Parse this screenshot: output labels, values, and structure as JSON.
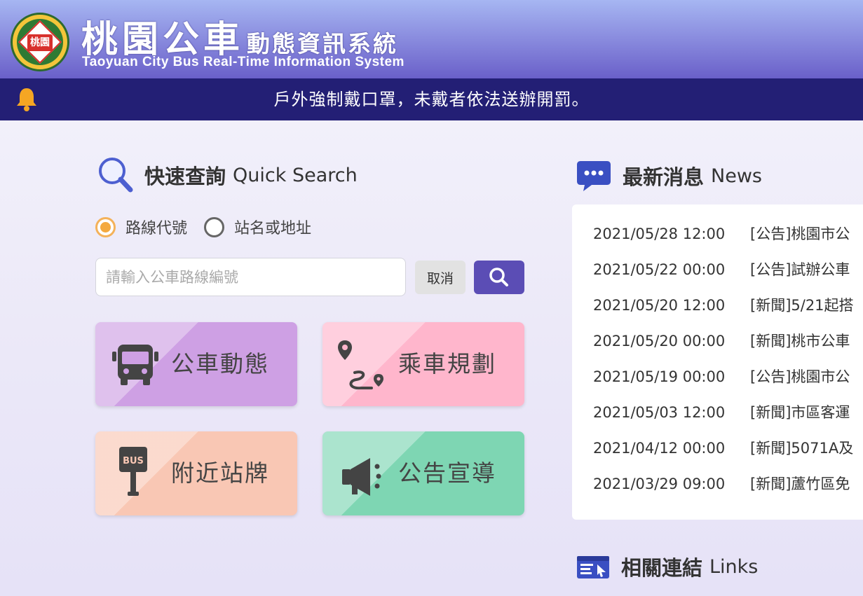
{
  "header": {
    "logo_text": "桃園",
    "title_main": "桃園公車",
    "title_sub": "動態資訊系統",
    "title_en": "Taoyuan City Bus Real-Time Information System"
  },
  "announcement": {
    "text": "戶外強制戴口罩，未戴者依法送辦開罰。"
  },
  "quick_search": {
    "title": "快速查詢",
    "title_en": "Quick Search",
    "options": [
      {
        "label": "路線代號",
        "checked": true
      },
      {
        "label": "站名或地址",
        "checked": false
      }
    ],
    "placeholder": "請輸入公車路線編號",
    "value": "",
    "cancel_label": "取消"
  },
  "tiles": [
    {
      "label": "公車動態",
      "icon": "bus-icon",
      "color": "#cea0e4"
    },
    {
      "label": "乘車規劃",
      "icon": "route-icon",
      "color": "#ffb6cc"
    },
    {
      "label": "附近站牌",
      "icon": "bus-stop-icon",
      "color": "#f9c7b4"
    },
    {
      "label": "公告宣導",
      "icon": "megaphone-icon",
      "color": "#7ed6b3"
    }
  ],
  "news": {
    "title": "最新消息",
    "title_en": "News",
    "items": [
      {
        "date": "2021/05/28 12:00",
        "title": "[公告]桃園市公"
      },
      {
        "date": "2021/05/22 00:00",
        "title": "[公告]試辦公車"
      },
      {
        "date": "2021/05/20 12:00",
        "title": "[新聞]5/21起搭"
      },
      {
        "date": "2021/05/20 00:00",
        "title": "[新聞]桃市公車"
      },
      {
        "date": "2021/05/19 00:00",
        "title": "[公告]桃園市公"
      },
      {
        "date": "2021/05/03 12:00",
        "title": "[新聞]市區客運"
      },
      {
        "date": "2021/04/12 00:00",
        "title": "[新聞]5071A及"
      },
      {
        "date": "2021/03/29 09:00",
        "title": "[新聞]蘆竹區免"
      }
    ]
  },
  "links": {
    "title": "相關連結",
    "title_en": "Links"
  }
}
